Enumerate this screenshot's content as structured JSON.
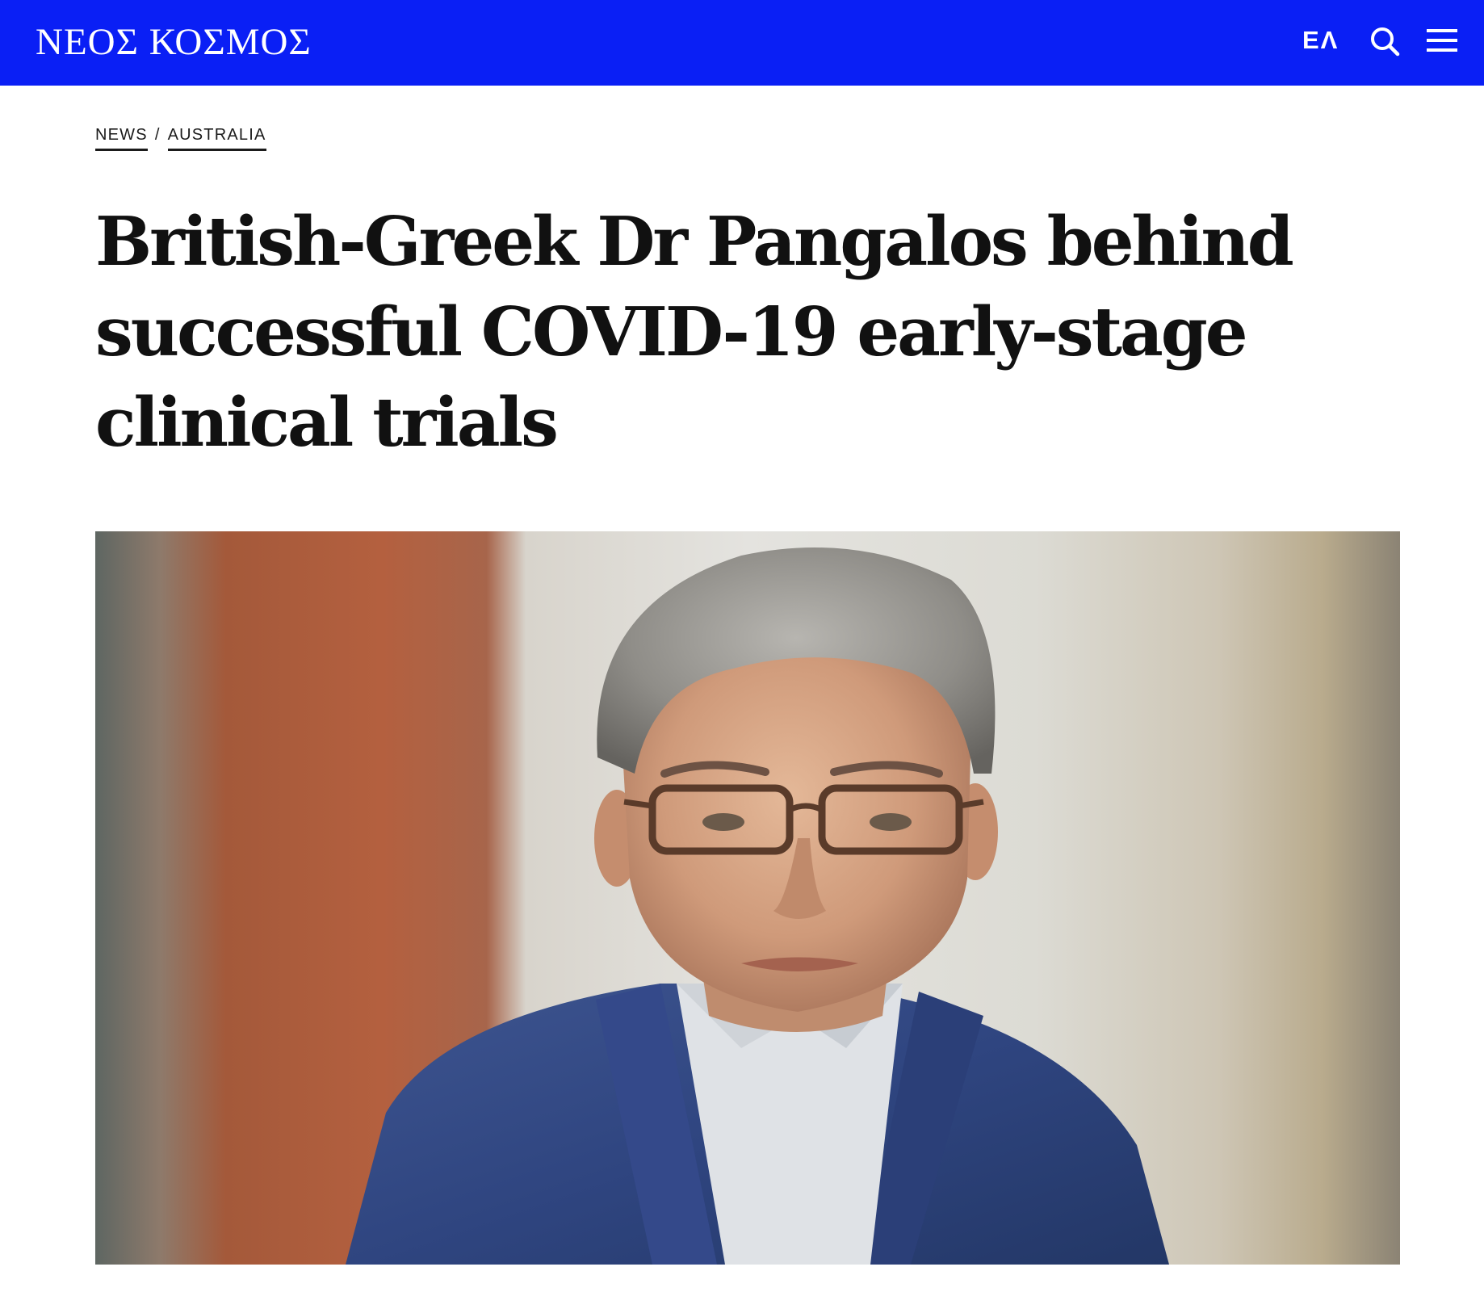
{
  "header": {
    "logo_text": "ΝΕΟΣ ΚΟΣΜΟΣ",
    "language_label": "ΕΛ",
    "search_icon": "search-icon",
    "menu_icon": "hamburger-menu-icon",
    "background_color": "#0a1ff5"
  },
  "breadcrumb": {
    "items": [
      {
        "label": "NEWS"
      },
      {
        "label": "AUSTRALIA"
      }
    ],
    "separator": "/"
  },
  "article": {
    "headline": "British-Greek Dr Pangalos behind successful COVID-19 early-stage clinical trials"
  }
}
